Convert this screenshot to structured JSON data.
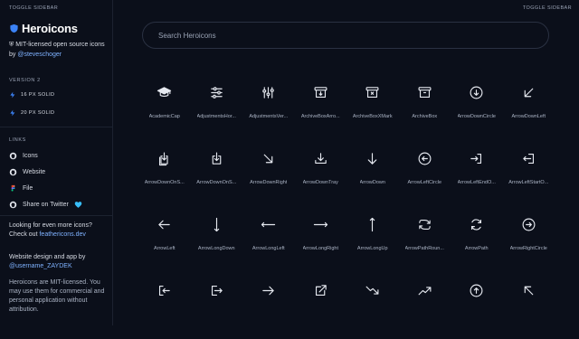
{
  "sidebar": {
    "toggle_label": "TOGGLE SIDEBAR",
    "brand": "Heroicons",
    "desc_text": "MIT-licensed open source icons by",
    "desc_link": "@steveschoger",
    "version_label": "VERSION 2",
    "versions": [
      "16 PX SOLID",
      "20 PX SOLID"
    ],
    "links_label": "LINKS",
    "links": [
      "Icons",
      "Website",
      "File",
      "Share on Twitter"
    ],
    "more_text": "Looking for even more icons? Check out",
    "more_link": "feathericons.dev",
    "design_text": "Website design and app by",
    "design_link": "@username_ZAYDEK",
    "license_text": "Heroicons are MIT-licensed. You may use them for commercial and personal application without attribution."
  },
  "main": {
    "toggle_label": "TOGGLE SIDEBAR",
    "search_placeholder": "Search Heroicons"
  },
  "icons": [
    {
      "icon": "academic-cap-icon",
      "label": "AcademicCap"
    },
    {
      "icon": "adjustments-horizontal-icon",
      "label": "AdjustmentsHor..."
    },
    {
      "icon": "adjustments-vertical-icon",
      "label": "AdjustmentsVer..."
    },
    {
      "icon": "archive-box-arrow-down-icon",
      "label": "ArchiveBoxArro..."
    },
    {
      "icon": "archive-box-x-mark-icon",
      "label": "ArchiveBoxXMark"
    },
    {
      "icon": "archive-box-icon",
      "label": "ArchiveBox"
    },
    {
      "icon": "arrow-down-circle-icon",
      "label": "ArrowDownCircle"
    },
    {
      "icon": "arrow-down-left-icon",
      "label": "ArrowDownLeft"
    },
    {
      "icon": "arrow-down-on-square-stack-icon",
      "label": "ArrowDownOnS..."
    },
    {
      "icon": "arrow-down-on-square-icon",
      "label": "ArrowDownOnS..."
    },
    {
      "icon": "arrow-down-right-icon",
      "label": "ArrowDownRight"
    },
    {
      "icon": "arrow-down-tray-icon",
      "label": "ArrowDownTray"
    },
    {
      "icon": "arrow-down-icon",
      "label": "ArrowDown"
    },
    {
      "icon": "arrow-left-circle-icon",
      "label": "ArrowLeftCircle"
    },
    {
      "icon": "arrow-left-end-on-rectangle-icon",
      "label": "ArrowLeftEndO..."
    },
    {
      "icon": "arrow-left-start-on-rectangle-icon",
      "label": "ArrowLeftStartO..."
    },
    {
      "icon": "arrow-left-icon",
      "label": "ArrowLeft"
    },
    {
      "icon": "arrow-long-down-icon",
      "label": "ArrowLongDown"
    },
    {
      "icon": "arrow-long-left-icon",
      "label": "ArrowLongLeft"
    },
    {
      "icon": "arrow-long-right-icon",
      "label": "ArrowLongRight"
    },
    {
      "icon": "arrow-long-up-icon",
      "label": "ArrowLongUp"
    },
    {
      "icon": "arrow-path-rounded-square-icon",
      "label": "ArrowPathRoun..."
    },
    {
      "icon": "arrow-path-icon",
      "label": "ArrowPath"
    },
    {
      "icon": "arrow-right-circle-icon",
      "label": "ArrowRightCircle"
    },
    {
      "icon": "arrow-right-end-on-rectangle-icon",
      "label": ""
    },
    {
      "icon": "arrow-right-start-on-rectangle-icon",
      "label": ""
    },
    {
      "icon": "arrow-right-icon",
      "label": ""
    },
    {
      "icon": "arrow-top-right-on-square-icon",
      "label": ""
    },
    {
      "icon": "arrow-trending-down-icon",
      "label": ""
    },
    {
      "icon": "arrow-trending-up-icon",
      "label": ""
    },
    {
      "icon": "arrow-up-circle-icon",
      "label": ""
    },
    {
      "icon": "arrow-up-left-icon",
      "label": ""
    }
  ],
  "colors": {
    "background": "#0b0f1a",
    "accent": "#3b82f6",
    "link": "#7fb2ff",
    "border": "#2a3142"
  }
}
